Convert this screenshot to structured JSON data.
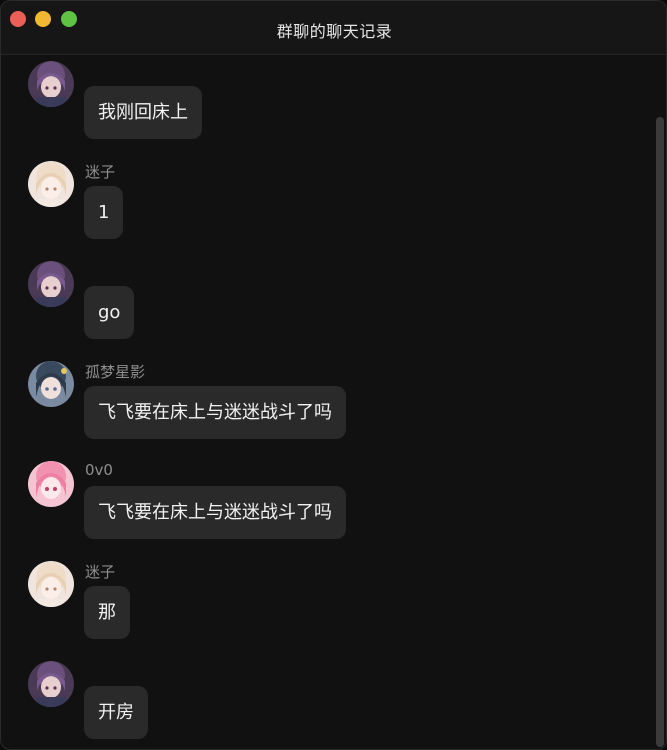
{
  "window": {
    "title": "群聊的聊天记录"
  },
  "colors": {
    "background": "#111111",
    "bubble": "#2a2a2a",
    "text": "#f2f2f2",
    "sender": "#8e8e8e",
    "close": "#ec5f57",
    "minimize": "#f2b733",
    "zoom": "#5fc244"
  },
  "messages": [
    {
      "sender": "",
      "avatar": "purple-hair-avatar",
      "text": "我刚回床上"
    },
    {
      "sender": "迷子",
      "avatar": "blonde-hair-avatar",
      "text": "1"
    },
    {
      "sender": "",
      "avatar": "purple-hair-avatar",
      "text": "go"
    },
    {
      "sender": "孤梦星影",
      "avatar": "dark-hair-avatar",
      "text": "飞飞要在床上与迷迷战斗了吗"
    },
    {
      "sender": "0v0",
      "avatar": "pink-hair-avatar",
      "text": "飞飞要在床上与迷迷战斗了吗"
    },
    {
      "sender": "迷子",
      "avatar": "blonde-hair-avatar",
      "text": "那"
    },
    {
      "sender": "",
      "avatar": "purple-hair-avatar",
      "text": "开房"
    }
  ]
}
